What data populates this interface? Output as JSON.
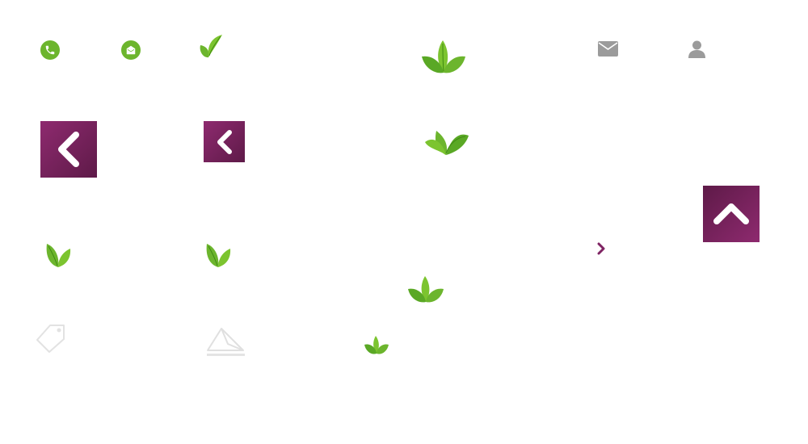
{
  "colors": {
    "green": "#6cb52d",
    "green_dark": "#3f8a12",
    "green_light": "#9ad63c",
    "purple": "#7f2463",
    "purple_dark": "#5e1a48",
    "gray": "#9b9b9b",
    "light_gray": "#e4e4e4"
  },
  "icons": [
    "phone-icon",
    "mail-open-icon",
    "leaf-icon",
    "leaves-icon",
    "envelope-icon",
    "user-icon",
    "chevron-left-icon",
    "chevron-up-icon",
    "chevron-right-icon",
    "tag-icon",
    "paper-plane-icon"
  ]
}
